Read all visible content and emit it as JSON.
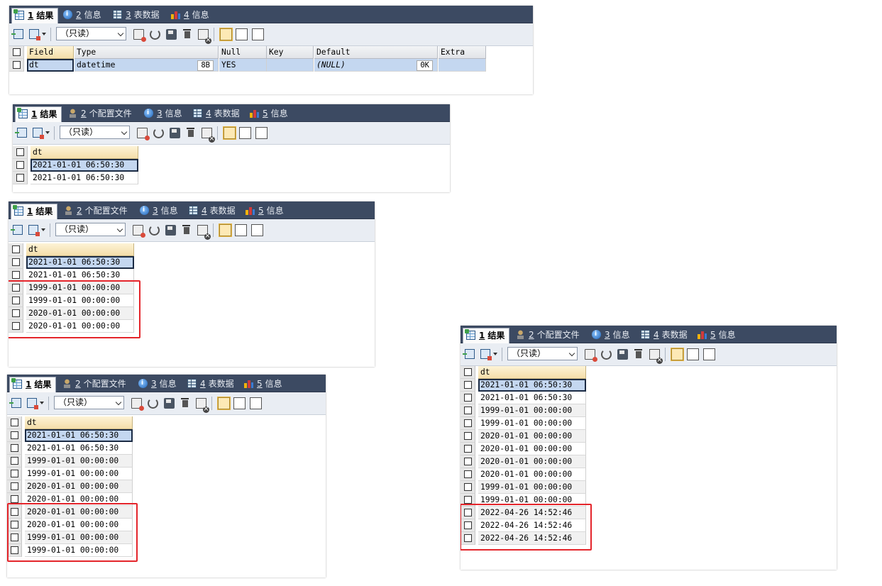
{
  "toolbar_select": "（只读）",
  "panel1": {
    "tabs": [
      {
        "num": "1",
        "label": "结果",
        "icon": "result-grid-icon"
      },
      {
        "num": "2",
        "label": "信息",
        "icon": "info-icon"
      },
      {
        "num": "3",
        "label": "表数据",
        "icon": "table-data-icon"
      },
      {
        "num": "4",
        "label": "信息",
        "icon": "info-chart-icon"
      }
    ],
    "columns": [
      "Field",
      "Type",
      "Null",
      "Key",
      "Default",
      "Extra"
    ],
    "row": {
      "field": "dt",
      "type": "datetime",
      "len": "8B",
      "null": "YES",
      "key": "",
      "default": "(NULL)",
      "default_len": "0K",
      "extra": ""
    }
  },
  "panel2": {
    "tabs": [
      {
        "num": "1",
        "label": "结果",
        "icon": "result-grid-icon"
      },
      {
        "num": "2",
        "label": "个配置文件",
        "icon": "profile-icon"
      },
      {
        "num": "3",
        "label": "信息",
        "icon": "info-icon"
      },
      {
        "num": "4",
        "label": "表数据",
        "icon": "table-data-icon"
      },
      {
        "num": "5",
        "label": "信息",
        "icon": "info-chart-icon"
      }
    ],
    "column": "dt",
    "rows": [
      "2021-01-01 06:50:30",
      "2021-01-01 06:50:30"
    ]
  },
  "panel3": {
    "tabs": [
      {
        "num": "1",
        "label": "结果",
        "icon": "result-grid-icon"
      },
      {
        "num": "2",
        "label": "个配置文件",
        "icon": "profile-icon"
      },
      {
        "num": "3",
        "label": "信息",
        "icon": "info-icon"
      },
      {
        "num": "4",
        "label": "表数据",
        "icon": "table-data-icon"
      },
      {
        "num": "5",
        "label": "信息",
        "icon": "info-chart-icon"
      }
    ],
    "column": "dt",
    "rows": [
      "2021-01-01 06:50:30",
      "2021-01-01 06:50:30",
      "1999-01-01 00:00:00",
      "1999-01-01 00:00:00",
      "2020-01-01 00:00:00",
      "2020-01-01 00:00:00"
    ]
  },
  "panel4": {
    "tabs": [
      {
        "num": "1",
        "label": "结果",
        "icon": "result-grid-icon"
      },
      {
        "num": "2",
        "label": "个配置文件",
        "icon": "profile-icon"
      },
      {
        "num": "3",
        "label": "信息",
        "icon": "info-icon"
      },
      {
        "num": "4",
        "label": "表数据",
        "icon": "table-data-icon"
      },
      {
        "num": "5",
        "label": "信息",
        "icon": "info-chart-icon"
      }
    ],
    "column": "dt",
    "rows": [
      "2021-01-01 06:50:30",
      "2021-01-01 06:50:30",
      "1999-01-01 00:00:00",
      "1999-01-01 00:00:00",
      "2020-01-01 00:00:00",
      "2020-01-01 00:00:00",
      "2020-01-01 00:00:00",
      "2020-01-01 00:00:00",
      "1999-01-01 00:00:00",
      "1999-01-01 00:00:00"
    ]
  },
  "panel5": {
    "tabs": [
      {
        "num": "1",
        "label": "结果",
        "icon": "result-grid-icon"
      },
      {
        "num": "2",
        "label": "个配置文件",
        "icon": "profile-icon"
      },
      {
        "num": "3",
        "label": "信息",
        "icon": "info-icon"
      },
      {
        "num": "4",
        "label": "表数据",
        "icon": "table-data-icon"
      },
      {
        "num": "5",
        "label": "信息",
        "icon": "info-chart-icon"
      }
    ],
    "column": "dt",
    "rows": [
      "2021-01-01 06:50:30",
      "2021-01-01 06:50:30",
      "1999-01-01 00:00:00",
      "1999-01-01 00:00:00",
      "2020-01-01 00:00:00",
      "2020-01-01 00:00:00",
      "2020-01-01 00:00:00",
      "2020-01-01 00:00:00",
      "1999-01-01 00:00:00",
      "1999-01-01 00:00:00",
      "2022-04-26 14:52:46",
      "2022-04-26 14:52:46",
      "2022-04-26 14:52:46"
    ]
  },
  "colors": {
    "tabbar": "#3c4a62",
    "header": "#f4deaa",
    "selected": "#c4d7f0",
    "highlight": "#e4252b"
  }
}
